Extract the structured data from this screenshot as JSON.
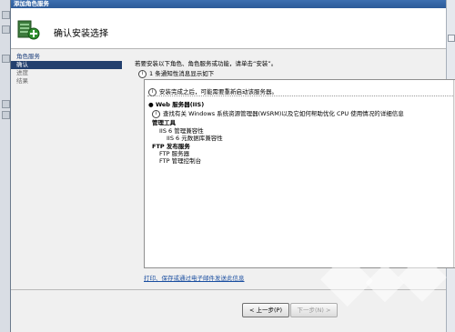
{
  "window": {
    "title": "添加角色服务"
  },
  "header": {
    "title": "确认安装选择"
  },
  "nav": {
    "items": [
      {
        "label": "角色服务",
        "state": "normal"
      },
      {
        "label": "确认",
        "state": "selected"
      },
      {
        "label": "进度",
        "state": "dim"
      },
      {
        "label": "结果",
        "state": "dim"
      }
    ]
  },
  "content": {
    "intro": "若要安装以下角色、角色服务或功能，请单击“安装”。",
    "message_count": "1 条通知性消息显示如下",
    "restart_note": "安装完成之后，可能需要重新启动该服务器。",
    "summary": {
      "role_title": "Web 服务器(IIS)",
      "info": "查找有关 Windows 系统资源管理器(WSRM)以及它如何帮助优化 CPU 使用情况的详细信息",
      "groups": [
        {
          "title": "管理工具",
          "items": [
            "IIS 6 管理兼容性",
            "IIS 6 元数据库兼容性"
          ]
        },
        {
          "title": "FTP 发布服务",
          "items": [
            "FTP 服务器",
            "FTP 管理控制台"
          ]
        }
      ]
    },
    "link": "打印、保存或通过电子邮件发送此信息"
  },
  "buttons": {
    "prev": "< 上一步(P)",
    "next": "下一步(N) >"
  },
  "colors": {
    "nav_selected": "#23406e",
    "titlebar": "#2c5a98",
    "link": "#1a4ea0"
  }
}
